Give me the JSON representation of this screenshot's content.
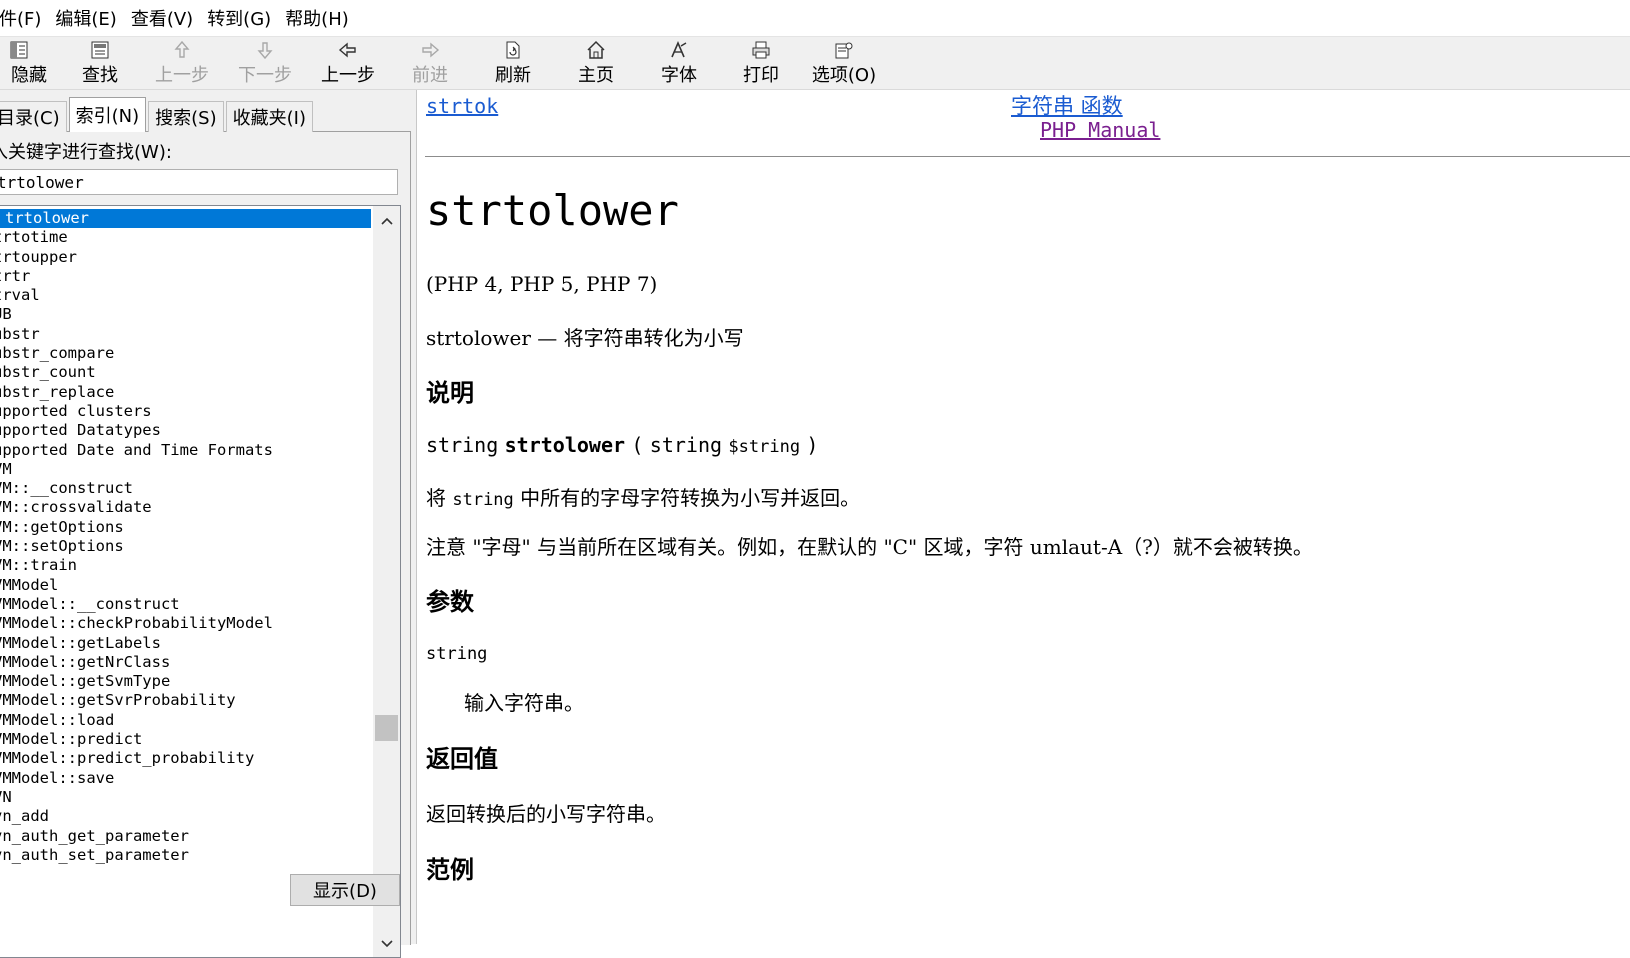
{
  "menubar": {
    "items": [
      "件(F)",
      "编辑(E)",
      "查看(V)",
      "转到(G)",
      "帮助(H)"
    ]
  },
  "toolbar": {
    "buttons": [
      {
        "label": "隐藏",
        "icon": "hide-pane-icon",
        "enabled": true
      },
      {
        "label": "查找",
        "icon": "find-icon",
        "enabled": true
      },
      {
        "label": "上一步",
        "icon": "up-arrow-icon",
        "enabled": false
      },
      {
        "label": "下一步",
        "icon": "down-arrow-icon",
        "enabled": false
      },
      {
        "label": "上一步",
        "icon": "back-arrow-icon",
        "enabled": true
      },
      {
        "label": "前进",
        "icon": "forward-arrow-icon",
        "enabled": false
      },
      {
        "label": "刷新",
        "icon": "refresh-icon",
        "enabled": true
      },
      {
        "label": "主页",
        "icon": "home-icon",
        "enabled": true
      },
      {
        "label": "字体",
        "icon": "font-icon",
        "enabled": true
      },
      {
        "label": "打印",
        "icon": "print-icon",
        "enabled": true
      },
      {
        "label": "选项(O)",
        "icon": "options-icon",
        "enabled": true
      }
    ]
  },
  "leftpane": {
    "tabs": [
      "目录(C)",
      "索引(N)",
      "搜索(S)",
      "收藏夹(I)"
    ],
    "active_tab": 1,
    "keyword_label": "入关键字进行查找(W):",
    "search_value": "trtolower",
    "list_items": [
      "trtolower",
      "trtotime",
      "trtoupper",
      "trtr",
      "trval",
      "UB",
      "ubstr",
      "ubstr_compare",
      "ubstr_count",
      "ubstr_replace",
      "upported clusters",
      "upported Datatypes",
      "upported Date and Time Formats",
      "VM",
      "VM::__construct",
      "VM::crossvalidate",
      "VM::getOptions",
      "VM::setOptions",
      "VM::train",
      "VMModel",
      "VMModel::__construct",
      "VMModel::checkProbabilityModel",
      "VMModel::getLabels",
      "VMModel::getNrClass",
      "VMModel::getSvmType",
      "VMModel::getSvrProbability",
      "VMModel::load",
      "VMModel::predict",
      "VMModel::predict_probability",
      "VMModel::save",
      "VN",
      "vn_add",
      "vn_auth_get_parameter",
      "vn_auth_set_parameter"
    ],
    "selected_index": 0,
    "show_button": "显示(D)"
  },
  "content": {
    "nav_prev": "strtok",
    "nav_up": "字符串 函数",
    "nav_manual": "PHP Manual",
    "title": "strtolower",
    "versions": "(PHP 4, PHP 5, PHP 7)",
    "refpurpose": "strtolower — 将字符串转化为小写",
    "h_description": "说明",
    "sig_type": "string",
    "sig_name": "strtolower",
    "sig_open": "(",
    "sig_ptype": "string",
    "sig_param": "$string",
    "sig_close": ")",
    "desc_pre": "将",
    "desc_code": "string",
    "desc_post": "中所有的字母字符转换为小写并返回。",
    "note": "注意 \"字母\" 与当前所在区域有关。例如，在默认的 \"C\" 区域，字符 umlaut-A（?）就不会被转换。",
    "h_params": "参数",
    "param_name": "string",
    "param_desc": "输入字符串。",
    "h_return": "返回值",
    "return_desc": "返回转换后的小写字符串。",
    "h_examples": "范例"
  }
}
